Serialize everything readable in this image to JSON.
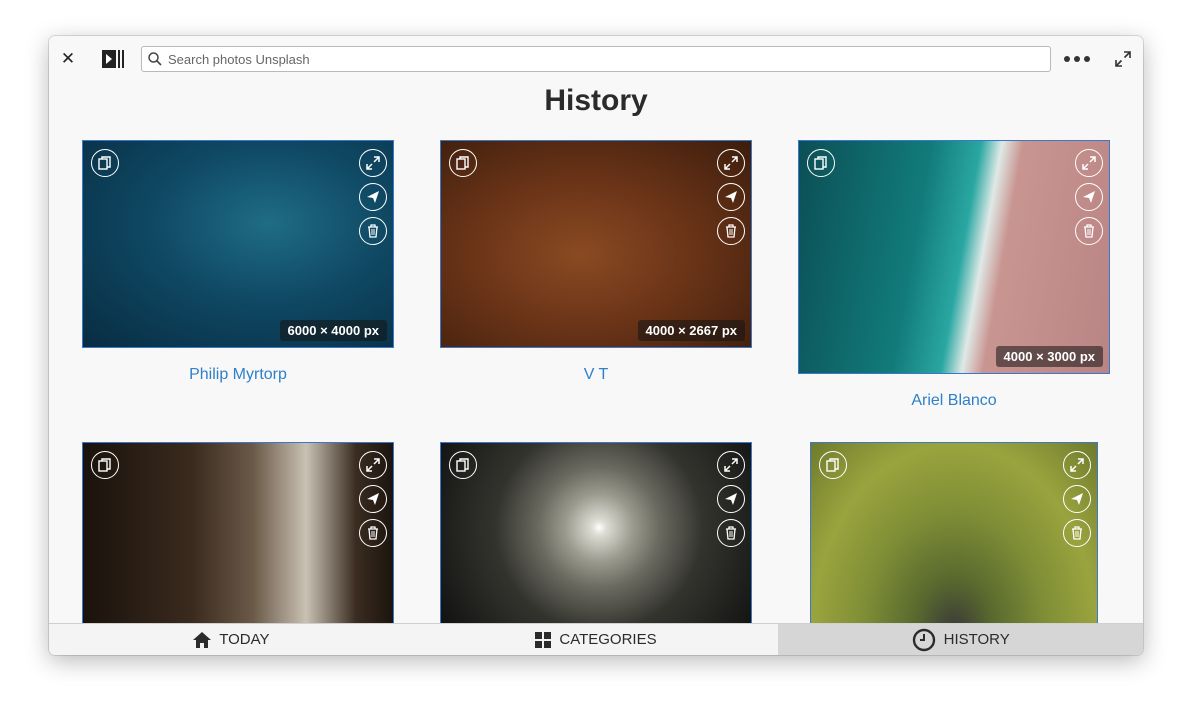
{
  "search": {
    "placeholder": "Search photos Unsplash"
  },
  "page": {
    "title": "History"
  },
  "photos": [
    {
      "author": "Philip Myrtorp",
      "resolution": "6000 × 4000  px"
    },
    {
      "author": "V T",
      "resolution": "4000 × 2667  px"
    },
    {
      "author": "Ariel Blanco",
      "resolution": "4000 × 3000  px"
    },
    {
      "author": "",
      "resolution": ""
    },
    {
      "author": "",
      "resolution": ""
    },
    {
      "author": "",
      "resolution": ""
    }
  ],
  "tabs": [
    {
      "label": "TODAY",
      "icon": "home-icon"
    },
    {
      "label": "CATEGORIES",
      "icon": "grid-icon"
    },
    {
      "label": "HISTORY",
      "icon": "clock-icon"
    }
  ],
  "active_tab": "HISTORY",
  "colors": {
    "accent": "#2f7fc9",
    "border": "#3a78c9",
    "active_tab_bg": "#d6d6d6"
  }
}
